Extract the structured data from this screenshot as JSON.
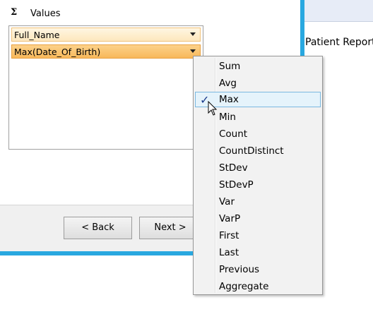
{
  "values_section": {
    "sigma": "Σ",
    "title": "Values",
    "fields": [
      {
        "label": "Full_Name"
      },
      {
        "label": "Max(Date_Of_Birth)"
      }
    ]
  },
  "buttons": {
    "back": "< Back",
    "next": "Next >"
  },
  "background": {
    "report_label": "Patient Report"
  },
  "aggregate_menu": {
    "selected": "Max",
    "check_mark": "✓",
    "items": [
      "Sum",
      "Avg",
      "Max",
      "Min",
      "Count",
      "CountDistinct",
      "StDev",
      "StDevP",
      "Var",
      "VarP",
      "First",
      "Last",
      "Previous",
      "Aggregate"
    ]
  },
  "colors": {
    "accent_border": "#29a8e0",
    "field_fill": "#fde7bd",
    "selected_field_fill": "#f8b85a",
    "menu_highlight": "#e5f3fb"
  }
}
